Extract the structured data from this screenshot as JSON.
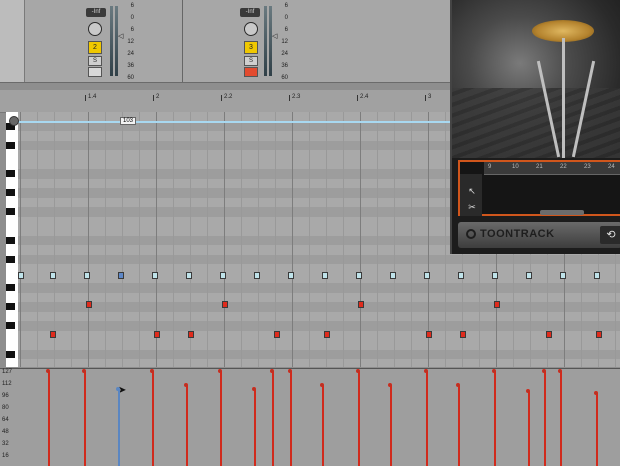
{
  "mixer": {
    "channels": [
      {
        "volume": "-Inf",
        "track_number": "2",
        "solo": "S",
        "scale": [
          "6",
          "0",
          "6",
          "12",
          "",
          "24",
          "36",
          "60"
        ]
      },
      {
        "volume": "-Inf",
        "track_number": "3",
        "solo": "S",
        "scale": [
          "6",
          "0",
          "6",
          "12",
          "",
          "24",
          "36",
          "60"
        ]
      }
    ]
  },
  "ruler": {
    "ticks": [
      "1.4",
      "2",
      "2.2",
      "2.3",
      "2.4",
      "3"
    ]
  },
  "loop": {
    "label": "103"
  },
  "velocity_lane": {
    "scale": [
      "127",
      "112",
      "96",
      "80",
      "64",
      "48",
      "32",
      "16"
    ]
  },
  "plugin": {
    "brand": "TOONTRACK",
    "grid_ruler": [
      "9",
      "10",
      "21",
      "22",
      "23",
      "24"
    ],
    "tools": [
      "arrow-icon",
      "scissors-icon"
    ],
    "loop_icon": "loop-icon"
  },
  "colors": {
    "note_cyan": "#bfe3ea",
    "note_blue": "#5d87c7",
    "note_red": "#e02b1c",
    "accent": "#d0561c"
  }
}
